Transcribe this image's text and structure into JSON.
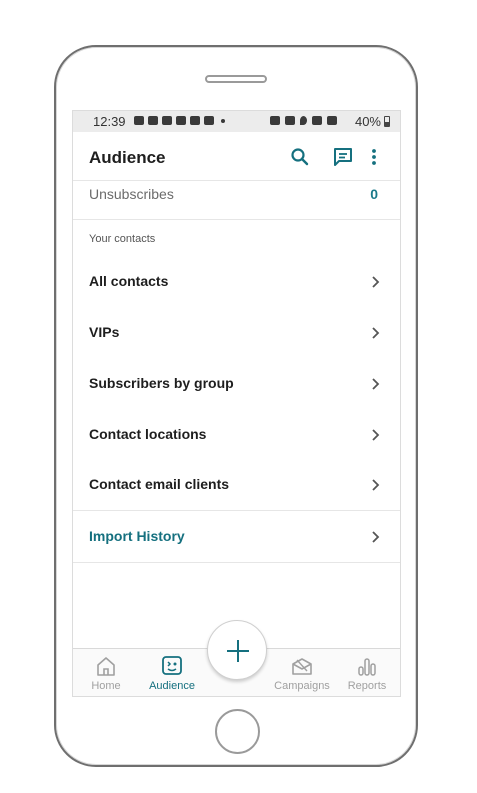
{
  "status_bar": {
    "time": "12:39",
    "battery": "40%"
  },
  "app_bar": {
    "title": "Audience",
    "icons": [
      "search-icon",
      "message-icon",
      "more-vertical-icon"
    ]
  },
  "unsubscribes": {
    "label": "Unsubscribes",
    "value": "0"
  },
  "contacts_section": {
    "header": "Your contacts",
    "items": [
      {
        "label": "All contacts"
      },
      {
        "label": "VIPs"
      },
      {
        "label": "Subscribers by group"
      },
      {
        "label": "Contact locations"
      },
      {
        "label": "Contact email clients"
      },
      {
        "label": "Import History"
      }
    ]
  },
  "bottom_nav": {
    "items": [
      {
        "label": "Home",
        "icon": "home-icon"
      },
      {
        "label": "Audience",
        "icon": "audience-icon"
      },
      {
        "label": "Campaigns",
        "icon": "campaigns-icon"
      },
      {
        "label": "Reports",
        "icon": "reports-icon"
      }
    ],
    "fab_icon": "plus-icon"
  },
  "colors": {
    "accent": "#15707f",
    "text": "#1e1e1e",
    "muted": "#a0a0a0"
  }
}
